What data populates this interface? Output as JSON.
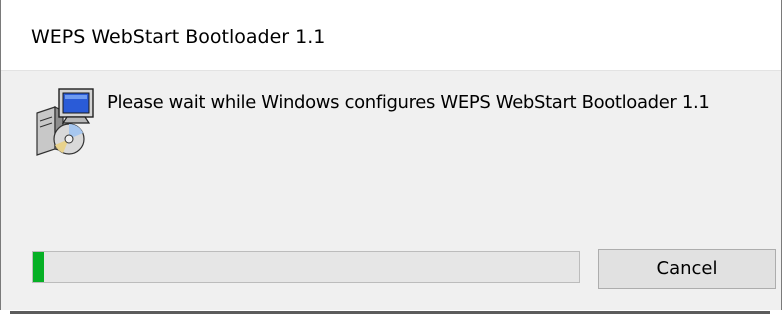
{
  "window": {
    "title": "WEPS WebStart Bootloader 1.1"
  },
  "body": {
    "message": "Please wait while Windows configures WEPS WebStart Bootloader 1.1",
    "icon": "installer-icon"
  },
  "progress": {
    "value_percent": 2,
    "fill_color": "#06b025"
  },
  "buttons": {
    "cancel_label": "Cancel"
  }
}
